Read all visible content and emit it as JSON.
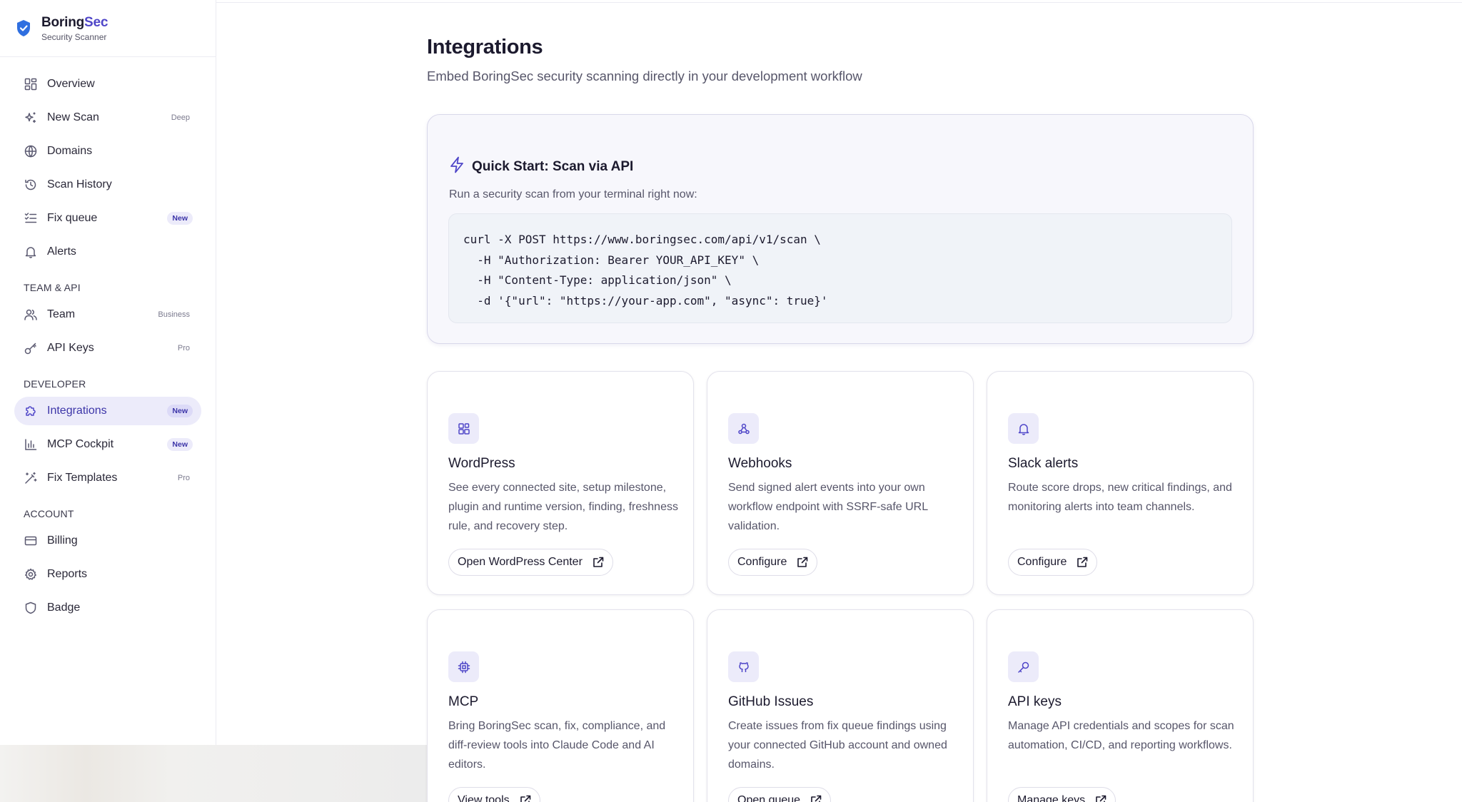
{
  "brand": {
    "name_a": "Boring",
    "name_b": "Sec",
    "subtitle": "Security Scanner"
  },
  "sidebar": {
    "main_items": [
      {
        "label": "Overview",
        "icon": "dashboard-icon",
        "badge": ""
      },
      {
        "label": "New Scan",
        "icon": "sparkles-icon",
        "badge": "Deep"
      },
      {
        "label": "Domains",
        "icon": "globe-icon",
        "badge": ""
      },
      {
        "label": "Scan History",
        "icon": "history-icon",
        "badge": ""
      },
      {
        "label": "Fix queue",
        "icon": "list-checks-icon",
        "badge": "New"
      },
      {
        "label": "Alerts",
        "icon": "bell-icon",
        "badge": ""
      }
    ],
    "team_section": "TEAM & API",
    "team_items": [
      {
        "label": "Team",
        "icon": "users-icon",
        "badge": "Business"
      },
      {
        "label": "API Keys",
        "icon": "key-icon",
        "badge": "Pro"
      }
    ],
    "developer_section": "DEVELOPER",
    "developer_items": [
      {
        "label": "Integrations",
        "icon": "puzzle-icon",
        "badge": "New",
        "active": true
      },
      {
        "label": "MCP Cockpit",
        "icon": "bar-chart-icon",
        "badge": "New"
      },
      {
        "label": "Fix Templates",
        "icon": "wand-icon",
        "badge": "Pro"
      }
    ],
    "account_section": "ACCOUNT",
    "account_items": [
      {
        "label": "Billing",
        "icon": "credit-card-icon",
        "badge": ""
      },
      {
        "label": "Reports",
        "icon": "gear-icon",
        "badge": ""
      },
      {
        "label": "Badge",
        "icon": "shield-icon",
        "badge": ""
      }
    ]
  },
  "main": {
    "title": "Integrations",
    "subtitle": "Embed BoringSec security scanning directly in your development workflow",
    "quickstart": {
      "title": "Quick Start: Scan via API",
      "description": "Run a security scan from your terminal right now:",
      "code": "curl -X POST https://www.boringsec.com/api/v1/scan \\\n  -H \"Authorization: Bearer YOUR_API_KEY\" \\\n  -H \"Content-Type: application/json\" \\\n  -d '{\"url\": \"https://your-app.com\", \"async\": true}'"
    },
    "cards": [
      {
        "title": "WordPress",
        "icon": "wordpress-grid-icon",
        "description": "See every connected site, setup milestone, plugin and runtime version, finding, freshness rule, and recovery step.",
        "button": "Open WordPress Center"
      },
      {
        "title": "Webhooks",
        "icon": "webhook-icon",
        "description": "Send signed alert events into your own workflow endpoint with SSRF-safe URL validation.",
        "button": "Configure"
      },
      {
        "title": "Slack alerts",
        "icon": "bell-icon",
        "description": "Route score drops, new critical findings, and monitoring alerts into team channels.",
        "button": "Configure"
      },
      {
        "title": "MCP",
        "icon": "chip-icon",
        "description": "Bring BoringSec scan, fix, compliance, and diff-review tools into Claude Code and AI editors.",
        "button": "View tools"
      },
      {
        "title": "GitHub Issues",
        "icon": "github-icon",
        "description": "Create issues from fix queue findings using your connected GitHub account and owned domains.",
        "button": "Open queue"
      },
      {
        "title": "API keys",
        "icon": "key-icon",
        "description": "Manage API credentials and scopes for scan automation, CI/CD, and reporting workflows.",
        "button": "Manage keys"
      }
    ]
  },
  "colors": {
    "accent": "#4f46c8",
    "active_bg": "#ecebfa",
    "muted_text": "#57566a"
  }
}
